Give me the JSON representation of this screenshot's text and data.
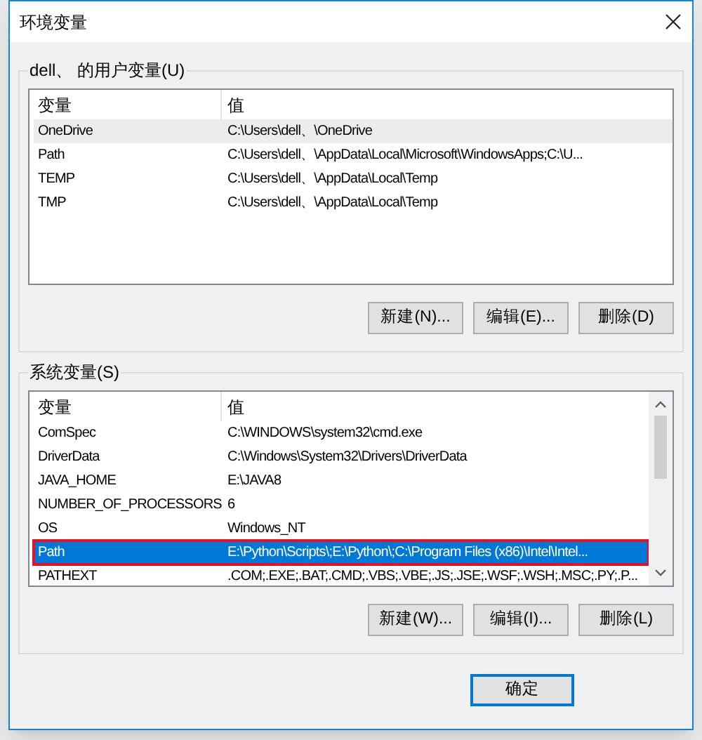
{
  "window": {
    "title": "环境变量"
  },
  "user_variables": {
    "label": "dell、 的用户变量(U)",
    "focused": false,
    "columns": [
      "变量",
      "值"
    ],
    "rows": [
      {
        "name": "OneDrive",
        "value": "C:\\Users\\dell、\\OneDrive",
        "selected": true,
        "outlined": false
      },
      {
        "name": "Path",
        "value": "C:\\Users\\dell、\\AppData\\Local\\Microsoft\\WindowsApps;C:\\U...",
        "selected": false,
        "outlined": false
      },
      {
        "name": "TEMP",
        "value": "C:\\Users\\dell、\\AppData\\Local\\Temp",
        "selected": false,
        "outlined": false
      },
      {
        "name": "TMP",
        "value": "C:\\Users\\dell、\\AppData\\Local\\Temp",
        "selected": false,
        "outlined": false
      }
    ],
    "buttons": [
      "新建(N)...",
      "编辑(E)...",
      "删除(D)"
    ]
  },
  "system_variables": {
    "label": "系统变量(S)",
    "focused": true,
    "columns": [
      "变量",
      "值"
    ],
    "rows": [
      {
        "name": "ComSpec",
        "value": "C:\\WINDOWS\\system32\\cmd.exe",
        "selected": false,
        "outlined": false
      },
      {
        "name": "DriverData",
        "value": "C:\\Windows\\System32\\Drivers\\DriverData",
        "selected": false,
        "outlined": false
      },
      {
        "name": "JAVA_HOME",
        "value": "E:\\JAVA8",
        "selected": false,
        "outlined": false
      },
      {
        "name": "NUMBER_OF_PROCESSORS",
        "value": "6",
        "selected": false,
        "outlined": false
      },
      {
        "name": "OS",
        "value": "Windows_NT",
        "selected": false,
        "outlined": false
      },
      {
        "name": "Path",
        "value": "E:\\Python\\Scripts\\;E:\\Python\\;C:\\Program Files (x86)\\Intel\\Intel...",
        "selected": true,
        "outlined": true
      },
      {
        "name": "PATHEXT",
        "value": ".COM;.EXE;.BAT;.CMD;.VBS;.VBE;.JS;.JSE;.WSF;.WSH;.MSC;.PY;.P...",
        "selected": false,
        "outlined": false
      }
    ],
    "buttons": [
      "新建(W)...",
      "编辑(I)...",
      "删除(L)"
    ]
  },
  "footer_buttons": [
    "确定"
  ]
}
